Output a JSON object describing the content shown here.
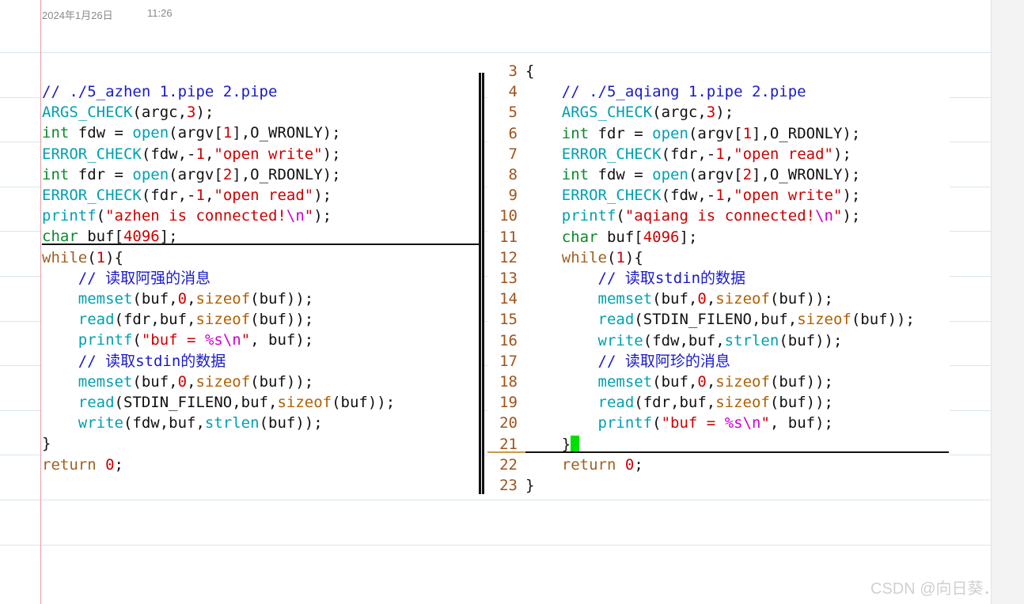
{
  "header": {
    "date": "2024年1月26日",
    "time": "11:26"
  },
  "colors": {
    "comment": "#1a1acc",
    "function": "#00a0b0",
    "type": "#0a8a2a",
    "string": "#cc0000",
    "escape": "#cc00cc",
    "sizeof": "#b06000",
    "line_number": "#a0521a",
    "cursor": "#00e000"
  },
  "left_pane": {
    "lines": [
      [
        [
          "c-cm",
          "// ./5_azhen 1.pipe 2.pipe"
        ]
      ],
      [
        [
          "c-fn",
          "ARGS_CHECK"
        ],
        [
          "c-tx",
          "(argc,"
        ],
        [
          "c-num",
          "3"
        ],
        [
          "c-tx",
          ");"
        ]
      ],
      [
        [
          "c-kw",
          "int"
        ],
        [
          "c-tx",
          " fdw = "
        ],
        [
          "c-fn",
          "open"
        ],
        [
          "c-tx",
          "(argv["
        ],
        [
          "c-num",
          "1"
        ],
        [
          "c-tx",
          "],O_WRONLY);"
        ]
      ],
      [
        [
          "c-fn",
          "ERROR_CHECK"
        ],
        [
          "c-tx",
          "(fdw,-"
        ],
        [
          "c-num",
          "1"
        ],
        [
          "c-tx",
          ","
        ],
        [
          "c-str",
          "\"open write\""
        ],
        [
          "c-tx",
          ");"
        ]
      ],
      [
        [
          "c-kw",
          "int"
        ],
        [
          "c-tx",
          " fdr = "
        ],
        [
          "c-fn",
          "open"
        ],
        [
          "c-tx",
          "(argv["
        ],
        [
          "c-num",
          "2"
        ],
        [
          "c-tx",
          "],O_RDONLY);"
        ]
      ],
      [
        [
          "c-fn",
          "ERROR_CHECK"
        ],
        [
          "c-tx",
          "(fdr,-"
        ],
        [
          "c-num",
          "1"
        ],
        [
          "c-tx",
          ","
        ],
        [
          "c-str",
          "\"open read\""
        ],
        [
          "c-tx",
          ");"
        ]
      ],
      [
        [
          "c-fn",
          "printf"
        ],
        [
          "c-tx",
          "("
        ],
        [
          "c-str",
          "\"azhen is connected!"
        ],
        [
          "c-esc",
          "\\n"
        ],
        [
          "c-str",
          "\""
        ],
        [
          "c-tx",
          ");"
        ]
      ],
      [
        [
          "c-kw",
          "char"
        ],
        [
          "c-tx",
          " buf["
        ],
        [
          "c-num",
          "4096"
        ],
        [
          "c-tx",
          "];"
        ]
      ],
      [
        [
          "c-ctl",
          "while"
        ],
        [
          "c-tx",
          "("
        ],
        [
          "c-num",
          "1"
        ],
        [
          "c-tx",
          "){"
        ]
      ],
      [
        [
          "c-tx",
          "    "
        ],
        [
          "c-cm",
          "// 读取阿强的消息"
        ]
      ],
      [
        [
          "c-tx",
          "    "
        ],
        [
          "c-fn",
          "memset"
        ],
        [
          "c-tx",
          "(buf,"
        ],
        [
          "c-num",
          "0"
        ],
        [
          "c-tx",
          ","
        ],
        [
          "c-sz",
          "sizeof"
        ],
        [
          "c-tx",
          "(buf));"
        ]
      ],
      [
        [
          "c-tx",
          "    "
        ],
        [
          "c-fn",
          "read"
        ],
        [
          "c-tx",
          "(fdr,buf,"
        ],
        [
          "c-sz",
          "sizeof"
        ],
        [
          "c-tx",
          "(buf));"
        ]
      ],
      [
        [
          "c-tx",
          "    "
        ],
        [
          "c-fn",
          "printf"
        ],
        [
          "c-tx",
          "("
        ],
        [
          "c-str",
          "\"buf = "
        ],
        [
          "c-esc",
          "%s\\n"
        ],
        [
          "c-str",
          "\""
        ],
        [
          "c-tx",
          ", buf);"
        ]
      ],
      [
        [
          "c-tx",
          "    "
        ],
        [
          "c-cm",
          "// 读取stdin的数据"
        ]
      ],
      [
        [
          "c-tx",
          "    "
        ],
        [
          "c-fn",
          "memset"
        ],
        [
          "c-tx",
          "(buf,"
        ],
        [
          "c-num",
          "0"
        ],
        [
          "c-tx",
          ","
        ],
        [
          "c-sz",
          "sizeof"
        ],
        [
          "c-tx",
          "(buf));"
        ]
      ],
      [
        [
          "c-tx",
          "    "
        ],
        [
          "c-fn",
          "read"
        ],
        [
          "c-tx",
          "(STDIN_FILENO,buf,"
        ],
        [
          "c-sz",
          "sizeof"
        ],
        [
          "c-tx",
          "(buf));"
        ]
      ],
      [
        [
          "c-tx",
          "    "
        ],
        [
          "c-fn",
          "write"
        ],
        [
          "c-tx",
          "(fdw,buf,"
        ],
        [
          "c-fn",
          "strlen"
        ],
        [
          "c-tx",
          "(buf));"
        ]
      ],
      [
        [
          "c-tx",
          "}"
        ]
      ],
      [
        [
          "c-ctl",
          "return"
        ],
        [
          "c-tx",
          " "
        ],
        [
          "c-num",
          "0"
        ],
        [
          "c-tx",
          ";"
        ]
      ]
    ]
  },
  "right_pane": {
    "lines": [
      {
        "n": "3",
        "segs": [
          [
            "c-tx",
            "{"
          ]
        ]
      },
      {
        "n": "4",
        "segs": [
          [
            "c-tx",
            "    "
          ],
          [
            "c-cm",
            "// ./5_aqiang 1.pipe 2.pipe"
          ]
        ]
      },
      {
        "n": "5",
        "segs": [
          [
            "c-tx",
            "    "
          ],
          [
            "c-fn",
            "ARGS_CHECK"
          ],
          [
            "c-tx",
            "(argc,"
          ],
          [
            "c-num",
            "3"
          ],
          [
            "c-tx",
            ");"
          ]
        ]
      },
      {
        "n": "6",
        "segs": [
          [
            "c-tx",
            "    "
          ],
          [
            "c-kw",
            "int"
          ],
          [
            "c-tx",
            " fdr = "
          ],
          [
            "c-fn",
            "open"
          ],
          [
            "c-tx",
            "(argv["
          ],
          [
            "c-num",
            "1"
          ],
          [
            "c-tx",
            "],O_RDONLY);"
          ]
        ]
      },
      {
        "n": "7",
        "segs": [
          [
            "c-tx",
            "    "
          ],
          [
            "c-fn",
            "ERROR_CHECK"
          ],
          [
            "c-tx",
            "(fdr,-"
          ],
          [
            "c-num",
            "1"
          ],
          [
            "c-tx",
            ","
          ],
          [
            "c-str",
            "\"open read\""
          ],
          [
            "c-tx",
            ");"
          ]
        ]
      },
      {
        "n": "8",
        "segs": [
          [
            "c-tx",
            "    "
          ],
          [
            "c-kw",
            "int"
          ],
          [
            "c-tx",
            " fdw = "
          ],
          [
            "c-fn",
            "open"
          ],
          [
            "c-tx",
            "(argv["
          ],
          [
            "c-num",
            "2"
          ],
          [
            "c-tx",
            "],O_WRONLY);"
          ]
        ]
      },
      {
        "n": "9",
        "segs": [
          [
            "c-tx",
            "    "
          ],
          [
            "c-fn",
            "ERROR_CHECK"
          ],
          [
            "c-tx",
            "(fdw,-"
          ],
          [
            "c-num",
            "1"
          ],
          [
            "c-tx",
            ","
          ],
          [
            "c-str",
            "\"open write\""
          ],
          [
            "c-tx",
            ");"
          ]
        ]
      },
      {
        "n": "10",
        "segs": [
          [
            "c-tx",
            "    "
          ],
          [
            "c-fn",
            "printf"
          ],
          [
            "c-tx",
            "("
          ],
          [
            "c-str",
            "\"aqiang is connected!"
          ],
          [
            "c-esc",
            "\\n"
          ],
          [
            "c-str",
            "\""
          ],
          [
            "c-tx",
            ");"
          ]
        ]
      },
      {
        "n": "11",
        "segs": [
          [
            "c-tx",
            "    "
          ],
          [
            "c-kw",
            "char"
          ],
          [
            "c-tx",
            " buf["
          ],
          [
            "c-num",
            "4096"
          ],
          [
            "c-tx",
            "];"
          ]
        ]
      },
      {
        "n": "12",
        "segs": [
          [
            "c-tx",
            "    "
          ],
          [
            "c-ctl",
            "while"
          ],
          [
            "c-tx",
            "("
          ],
          [
            "c-num",
            "1"
          ],
          [
            "c-tx",
            "){"
          ]
        ]
      },
      {
        "n": "13",
        "segs": [
          [
            "c-tx",
            "        "
          ],
          [
            "c-cm",
            "// 读取stdin的数据"
          ]
        ]
      },
      {
        "n": "14",
        "segs": [
          [
            "c-tx",
            "        "
          ],
          [
            "c-fn",
            "memset"
          ],
          [
            "c-tx",
            "(buf,"
          ],
          [
            "c-num",
            "0"
          ],
          [
            "c-tx",
            ","
          ],
          [
            "c-sz",
            "sizeof"
          ],
          [
            "c-tx",
            "(buf));"
          ]
        ]
      },
      {
        "n": "15",
        "segs": [
          [
            "c-tx",
            "        "
          ],
          [
            "c-fn",
            "read"
          ],
          [
            "c-tx",
            "(STDIN_FILENO,buf,"
          ],
          [
            "c-sz",
            "sizeof"
          ],
          [
            "c-tx",
            "(buf));"
          ]
        ]
      },
      {
        "n": "16",
        "segs": [
          [
            "c-tx",
            "        "
          ],
          [
            "c-fn",
            "write"
          ],
          [
            "c-tx",
            "(fdw,buf,"
          ],
          [
            "c-fn",
            "strlen"
          ],
          [
            "c-tx",
            "(buf));"
          ]
        ]
      },
      {
        "n": "17",
        "segs": [
          [
            "c-tx",
            "        "
          ],
          [
            "c-cm",
            "// 读取阿珍的消息"
          ]
        ]
      },
      {
        "n": "18",
        "segs": [
          [
            "c-tx",
            "        "
          ],
          [
            "c-fn",
            "memset"
          ],
          [
            "c-tx",
            "(buf,"
          ],
          [
            "c-num",
            "0"
          ],
          [
            "c-tx",
            ","
          ],
          [
            "c-sz",
            "sizeof"
          ],
          [
            "c-tx",
            "(buf));"
          ]
        ]
      },
      {
        "n": "19",
        "segs": [
          [
            "c-tx",
            "        "
          ],
          [
            "c-fn",
            "read"
          ],
          [
            "c-tx",
            "(fdr,buf,"
          ],
          [
            "c-sz",
            "sizeof"
          ],
          [
            "c-tx",
            "(buf));"
          ]
        ]
      },
      {
        "n": "20",
        "segs": [
          [
            "c-tx",
            "        "
          ],
          [
            "c-fn",
            "printf"
          ],
          [
            "c-tx",
            "("
          ],
          [
            "c-str",
            "\"buf = "
          ],
          [
            "c-esc",
            "%s\\n"
          ],
          [
            "c-str",
            "\""
          ],
          [
            "c-tx",
            ", buf);"
          ]
        ]
      },
      {
        "n": "21",
        "segs": [
          [
            "c-tx",
            "    }"
          ]
        ],
        "cursor": true
      },
      {
        "n": "22",
        "segs": [
          [
            "c-tx",
            "    "
          ],
          [
            "c-ctl",
            "return"
          ],
          [
            "c-tx",
            " "
          ],
          [
            "c-num",
            "0"
          ],
          [
            "c-tx",
            ";"
          ]
        ]
      },
      {
        "n": "23",
        "segs": [
          [
            "c-tx",
            "}"
          ]
        ]
      }
    ]
  },
  "watermark": "CSDN @向日葵．"
}
